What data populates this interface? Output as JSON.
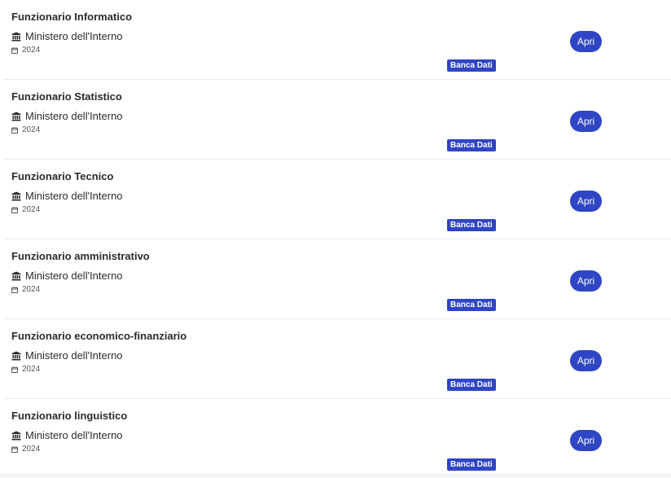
{
  "items": [
    {
      "title": "Funzionario Informatico",
      "org": "Ministero dell'Interno",
      "year": "2024",
      "badge": "Banca Dati",
      "button": "Apri"
    },
    {
      "title": "Funzionario Statistico",
      "org": "Ministero dell'Interno",
      "year": "2024",
      "badge": "Banca Dati",
      "button": "Apri"
    },
    {
      "title": "Funzionario Tecnico",
      "org": "Ministero dell'Interno",
      "year": "2024",
      "badge": "Banca Dati",
      "button": "Apri"
    },
    {
      "title": "Funzionario amministrativo",
      "org": "Ministero dell'Interno",
      "year": "2024",
      "badge": "Banca Dati",
      "button": "Apri"
    },
    {
      "title": "Funzionario economico-finanziario",
      "org": "Ministero dell'Interno",
      "year": "2024",
      "badge": "Banca Dati",
      "button": "Apri"
    },
    {
      "title": "Funzionario linguistico",
      "org": "Ministero dell'Interno",
      "year": "2024",
      "badge": "Banca Dati",
      "button": "Apri"
    }
  ],
  "icons": {
    "org": "institution-icon",
    "year": "calendar-icon"
  },
  "colors": {
    "accent": "#2f45c5",
    "text": "#2b2b2b",
    "divider": "#ececec"
  }
}
